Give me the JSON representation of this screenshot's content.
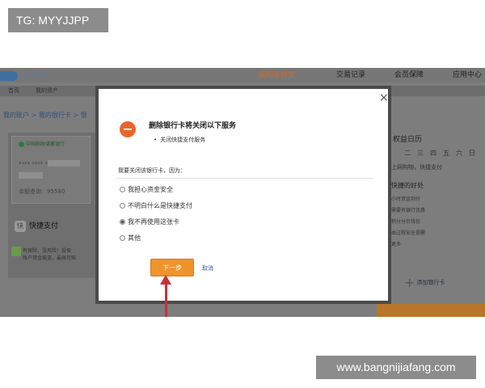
{
  "watermarks": {
    "tag": "TG: MYYJJPP",
    "url": "www.bangnijiafang.com"
  },
  "app": {
    "logo": "ALIPAY",
    "topnav": [
      "我的支付宝",
      "交易记录",
      "会员保障",
      "应用中心"
    ],
    "subnav": [
      "首页",
      "我的资产"
    ],
    "breadcrumb": "我的账户 > 我的银行卡 > 银"
  },
  "card": {
    "bank_name": "中国邮政储蓄银行",
    "card_number": "**** **** ****",
    "balance_label": "余额查询：95580"
  },
  "quick_pay": {
    "label": "快捷支付",
    "icon_text": "快"
  },
  "safety": {
    "line1": "有保险，没风险！投保",
    "line2": "账户资金被盗，最高可赔"
  },
  "right_panel": {
    "title": "权益日历",
    "calendar": [
      "二",
      "三",
      "四",
      "五",
      "六",
      "日"
    ],
    "line1": "上网购物，快捷支付",
    "title2": "快捷的好处",
    "benefits": [
      "小时资金到付",
      "需要有银行优惠",
      "积分分台钱包",
      "由过程安全提醒",
      "更多"
    ],
    "add_card": "添加银行卡"
  },
  "dialog": {
    "close_symbol": "×",
    "title": "删除银行卡将关闭以下服务",
    "service": "关闭快捷支付服务",
    "question": "我要关闭该银行卡，因为：",
    "options": [
      {
        "label": "我担心资金安全",
        "checked": false
      },
      {
        "label": "不明白什么是快捷支付",
        "checked": false
      },
      {
        "label": "我不再使用这张卡",
        "checked": true
      },
      {
        "label": "其他",
        "checked": false
      }
    ],
    "next_label": "下一步",
    "cancel_label": "取消"
  },
  "colors": {
    "accent": "#f0932a",
    "warning": "#e8672a",
    "arrow": "#c8303a"
  }
}
